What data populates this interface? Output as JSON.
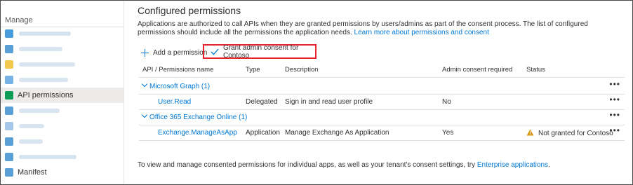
{
  "sidebar": {
    "heading": "Manage",
    "items": [
      {
        "label": "",
        "icon": "branding-icon",
        "color": "#4a9ede",
        "blur_w": 74
      },
      {
        "label": "",
        "icon": "authentication-icon",
        "color": "#5a9fd6",
        "blur_w": 62
      },
      {
        "label": "",
        "icon": "key-icon",
        "color": "#f2c94c",
        "blur_w": 80
      },
      {
        "label": "",
        "icon": "token-icon",
        "color": "#76b2e6",
        "blur_w": 70
      },
      {
        "label": "API permissions",
        "icon": "api-permissions-icon",
        "color": "#0f9d58",
        "active": true
      },
      {
        "label": "",
        "icon": "expose-api-icon",
        "color": "#5a9fd6",
        "blur_w": 58
      },
      {
        "label": "",
        "icon": "app-roles-icon",
        "color": "#a5c8e8",
        "blur_w": 36
      },
      {
        "label": "",
        "icon": "owners-icon",
        "color": "#5a9fd6",
        "blur_w": 34
      },
      {
        "label": "",
        "icon": "roles-admins-icon",
        "color": "#5a9fd6",
        "blur_w": 82
      },
      {
        "label": "Manifest",
        "icon": "manifest-icon",
        "color": "#5a9fd6"
      }
    ]
  },
  "main": {
    "title": "Configured permissions",
    "intro_text": "Applications are authorized to call APIs when they are granted permissions by users/admins as part of the consent process. The list of configured permissions should include all the permissions the application needs. ",
    "intro_link": "Learn more about permissions and consent",
    "add_permission": "Add a permission",
    "grant_consent": "Grant admin consent for Contoso",
    "columns": [
      "API / Permissions name",
      "Type",
      "Description",
      "Admin consent required",
      "Status"
    ],
    "groups": [
      {
        "name": "Microsoft Graph (1)",
        "rows": [
          {
            "name": "User.Read",
            "type": "Delegated",
            "description": "Sign in and read user profile",
            "admin": "No",
            "status": ""
          }
        ]
      },
      {
        "name": "Office 365 Exchange Online (1)",
        "rows": [
          {
            "name": "Exchange.ManageAsApp",
            "type": "Application",
            "description": "Manage Exchange As Application",
            "admin": "Yes",
            "status": "Not granted for Contoso"
          }
        ]
      }
    ],
    "ellipsis": "•••",
    "footer_text": "To view and manage consented permissions for individual apps, as well as your tenant's consent settings, try ",
    "footer_link": "Enterprise applications",
    "footer_end": "."
  }
}
